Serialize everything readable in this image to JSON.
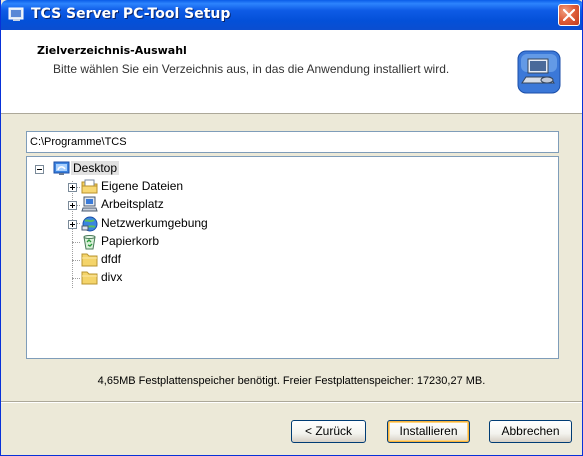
{
  "window": {
    "title": "TCS Server PC-Tool Setup"
  },
  "header": {
    "title": "Zielverzeichnis-Auswahl",
    "description": "Bitte wählen Sie ein Verzeichnis aus, in das die Anwendung installiert wird."
  },
  "path": {
    "value": "C:\\Programme\\TCS"
  },
  "tree": {
    "root": {
      "label": "Desktop",
      "icon": "desktop-icon"
    },
    "items": [
      {
        "label": "Eigene Dateien",
        "icon": "my-documents-icon",
        "expandable": true
      },
      {
        "label": "Arbeitsplatz",
        "icon": "my-computer-icon",
        "expandable": true
      },
      {
        "label": "Netzwerkumgebung",
        "icon": "network-places-icon",
        "expandable": true
      },
      {
        "label": "Papierkorb",
        "icon": "recycle-bin-icon",
        "expandable": false
      },
      {
        "label": "dfdf",
        "icon": "folder-icon",
        "expandable": false
      },
      {
        "label": "divx",
        "icon": "folder-icon",
        "expandable": false
      }
    ]
  },
  "status": {
    "text": "4,65MB Festplattenspeicher benötigt. Freier Festplattenspeicher: 17230,27 MB."
  },
  "buttons": {
    "back": "< Zurück",
    "install": "Installieren",
    "cancel": "Abbrechen"
  },
  "colors": {
    "titlebar": "#0054E3",
    "dialog": "#ECE9D8",
    "close": "#E0603C"
  }
}
